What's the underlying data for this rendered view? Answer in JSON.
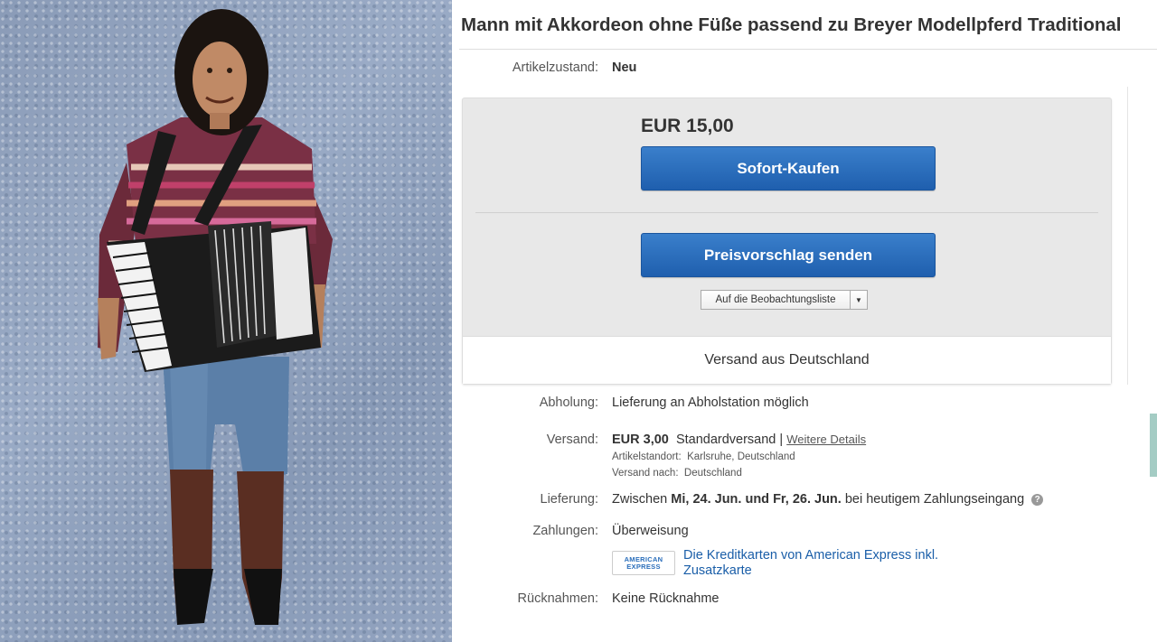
{
  "listing": {
    "title": "Mann mit Akkordeon ohne Füße passend zu Breyer Modellpferd Traditional",
    "condition_label": "Artikelzustand:",
    "condition_value": "Neu"
  },
  "buybox": {
    "price": "EUR 15,00",
    "buy_now_label": "Sofort-Kaufen",
    "offer_label": "Preisvorschlag senden",
    "watchlist_label": "Auf die Beobachtungsliste",
    "ships_from": "Versand aus Deutschland"
  },
  "details": {
    "pickup_label": "Abholung:",
    "pickup_value": "Lieferung an Abholstation möglich",
    "shipping_label": "Versand:",
    "shipping_price": "EUR 3,00",
    "shipping_method": "Standardversand",
    "shipping_separator": "|",
    "shipping_more_link": "Weitere Details",
    "item_location_label": "Artikelstandort:",
    "item_location_value": "Karlsruhe, Deutschland",
    "ships_to_label": "Versand nach:",
    "ships_to_value": "Deutschland",
    "delivery_label": "Lieferung:",
    "delivery_prefix": "Zwischen",
    "delivery_range": "Mi, 24. Jun. und Fr, 26. Jun.",
    "delivery_suffix": "bei heutigem Zahlungseingang",
    "payments_label": "Zahlungen:",
    "payments_value": "Überweisung",
    "amex_line1": "AMERICAN",
    "amex_line2": "EXPRESS",
    "amex_text": "Die Kreditkarten von American Express inkl. Zusatzkarte",
    "returns_label": "Rücknahmen:",
    "returns_value": "Keine Rücknahme"
  },
  "icons": {
    "help": "question-mark-circle",
    "dropdown": "triangle-down"
  },
  "colors": {
    "button_blue": "#2a6ebb",
    "link_blue": "#1a5ea8"
  }
}
